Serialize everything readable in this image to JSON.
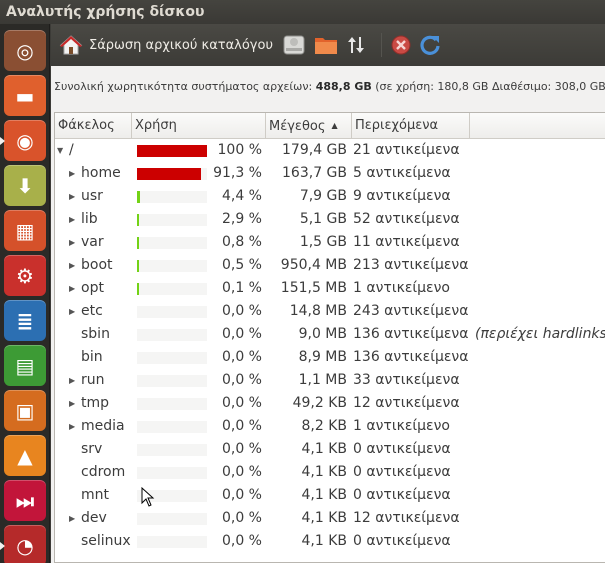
{
  "window": {
    "title": "Αναλυτής χρήσης δίσκου"
  },
  "launcher": {
    "items": [
      {
        "icon": "ubuntu-dash-icon",
        "color": "#8a4f33",
        "glyph": "◎",
        "active": false
      },
      {
        "icon": "files-icon",
        "color": "#e0602d",
        "glyph": "▬",
        "active": false
      },
      {
        "icon": "firefox-icon",
        "color": "#d9532b",
        "glyph": "◉",
        "active": true
      },
      {
        "icon": "archive-manager-icon",
        "color": "#a8b04a",
        "glyph": "⬇",
        "active": false
      },
      {
        "icon": "software-center-icon",
        "color": "#d5512a",
        "glyph": "▦",
        "active": false
      },
      {
        "icon": "system-settings-icon",
        "color": "#c9302c",
        "glyph": "⚙",
        "active": false
      },
      {
        "icon": "writer-icon",
        "color": "#2c6fb2",
        "glyph": "≣",
        "active": false
      },
      {
        "icon": "calc-icon",
        "color": "#3d9b35",
        "glyph": "▤",
        "active": false
      },
      {
        "icon": "impress-icon",
        "color": "#d56c1f",
        "glyph": "▣",
        "active": false
      },
      {
        "icon": "vlc-icon",
        "color": "#e8851f",
        "glyph": "▲",
        "active": false
      },
      {
        "icon": "media-player-icon",
        "color": "#c2153a",
        "glyph": "⏭",
        "active": false
      },
      {
        "icon": "disk-analyzer-icon",
        "color": "#b52a2a",
        "glyph": "◔",
        "active": true
      }
    ]
  },
  "toolbar": {
    "scan_home_label": "Σάρωση αρχικού καταλόγου"
  },
  "info": {
    "prefix": "Συνολική χωρητικότητα συστήματος αρχείων:",
    "total": "488,8 GB",
    "detail": "(σε χρήση: 180,8 GB Διαθέσιμο: 308,0 GB )"
  },
  "table": {
    "headers": {
      "folder": "Φάκελος",
      "usage": "Χρήση",
      "size": "Μέγεθος",
      "contents": "Περιεχόμενα"
    },
    "bar_colors": {
      "high": "#cc0000",
      "low": "#73d216"
    },
    "rows": [
      {
        "name": "/",
        "level": 0,
        "expander": "▼",
        "usage": "100 %",
        "fraction": 1.0,
        "color": "high",
        "size": "179,4 GB",
        "contents": "21 αντικείμενα",
        "note": ""
      },
      {
        "name": "home",
        "level": 1,
        "expander": "▶",
        "usage": "91,3 %",
        "fraction": 0.913,
        "color": "high",
        "size": "163,7 GB",
        "contents": "5 αντικείμενα",
        "note": ""
      },
      {
        "name": "usr",
        "level": 1,
        "expander": "▶",
        "usage": "4,4 %",
        "fraction": 0.044,
        "color": "low",
        "size": "7,9 GB",
        "contents": "9 αντικείμενα",
        "note": ""
      },
      {
        "name": "lib",
        "level": 1,
        "expander": "▶",
        "usage": "2,9 %",
        "fraction": 0.029,
        "color": "low",
        "size": "5,1 GB",
        "contents": "52 αντικείμενα",
        "note": ""
      },
      {
        "name": "var",
        "level": 1,
        "expander": "▶",
        "usage": "0,8 %",
        "fraction": 0.008,
        "color": "low",
        "size": "1,5 GB",
        "contents": "11 αντικείμενα",
        "note": ""
      },
      {
        "name": "boot",
        "level": 1,
        "expander": "▶",
        "usage": "0,5 %",
        "fraction": 0.005,
        "color": "low",
        "size": "950,4 MB",
        "contents": "213 αντικείμενα",
        "note": ""
      },
      {
        "name": "opt",
        "level": 1,
        "expander": "▶",
        "usage": "0,1 %",
        "fraction": 0.001,
        "color": "low",
        "size": "151,5 MB",
        "contents": "1 αντικείμενο",
        "note": ""
      },
      {
        "name": "etc",
        "level": 1,
        "expander": "▶",
        "usage": "0,0 %",
        "fraction": 0,
        "color": "low",
        "size": "14,8 MB",
        "contents": "243 αντικείμενα",
        "note": ""
      },
      {
        "name": "sbin",
        "level": 1,
        "expander": "",
        "usage": "0,0 %",
        "fraction": 0,
        "color": "low",
        "size": "9,0 MB",
        "contents": "136 αντικείμενα",
        "note": "(περιέχει hardlinks"
      },
      {
        "name": "bin",
        "level": 1,
        "expander": "",
        "usage": "0,0 %",
        "fraction": 0,
        "color": "low",
        "size": "8,9 MB",
        "contents": "136 αντικείμενα",
        "note": ""
      },
      {
        "name": "run",
        "level": 1,
        "expander": "▶",
        "usage": "0,0 %",
        "fraction": 0,
        "color": "low",
        "size": "1,1 MB",
        "contents": "33 αντικείμενα",
        "note": ""
      },
      {
        "name": "tmp",
        "level": 1,
        "expander": "▶",
        "usage": "0,0 %",
        "fraction": 0,
        "color": "low",
        "size": "49,2 KB",
        "contents": "12 αντικείμενα",
        "note": ""
      },
      {
        "name": "media",
        "level": 1,
        "expander": "▶",
        "usage": "0,0 %",
        "fraction": 0,
        "color": "low",
        "size": "8,2 KB",
        "contents": "1 αντικείμενο",
        "note": ""
      },
      {
        "name": "srv",
        "level": 1,
        "expander": "",
        "usage": "0,0 %",
        "fraction": 0,
        "color": "low",
        "size": "4,1 KB",
        "contents": "0 αντικείμενα",
        "note": ""
      },
      {
        "name": "cdrom",
        "level": 1,
        "expander": "",
        "usage": "0,0 %",
        "fraction": 0,
        "color": "low",
        "size": "4,1 KB",
        "contents": "0 αντικείμενα",
        "note": ""
      },
      {
        "name": "mnt",
        "level": 1,
        "expander": "",
        "usage": "0,0 %",
        "fraction": 0,
        "color": "low",
        "size": "4,1 KB",
        "contents": "0 αντικείμενα",
        "note": ""
      },
      {
        "name": "dev",
        "level": 1,
        "expander": "▶",
        "usage": "0,0 %",
        "fraction": 0,
        "color": "low",
        "size": "4,1 KB",
        "contents": "12 αντικείμενα",
        "note": ""
      },
      {
        "name": "selinux",
        "level": 1,
        "expander": "",
        "usage": "0,0 %",
        "fraction": 0,
        "color": "low",
        "size": "4,1 KB",
        "contents": "0 αντικείμενα",
        "note": ""
      }
    ]
  }
}
